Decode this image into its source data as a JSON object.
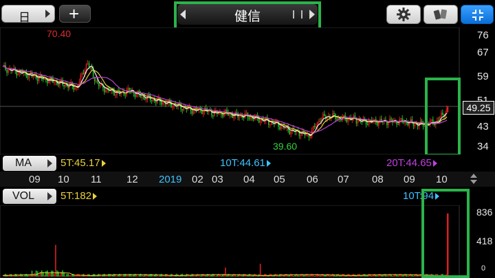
{
  "toolbar": {
    "period_label": "日",
    "add_label": "+",
    "stock_name": "健信",
    "colors": {
      "highlight": "#2bb34a",
      "fullscreen": "#1e90ff"
    }
  },
  "price_panel": {
    "y_ticks": [
      "76",
      "67",
      "59",
      "51",
      "43",
      "34"
    ],
    "current_price": "49.25",
    "high_label": "70.40",
    "low_label": "39.60",
    "colors": {
      "up": "#e01e1e",
      "down": "#1fbf2a",
      "ma5": "#f0f0f0",
      "ma10": "#e6d23a",
      "ma20": "#c040e0"
    }
  },
  "ma_bar": {
    "label": "MA",
    "ma5": "5T:45.17",
    "ma10": "10T:44.61",
    "ma20": "20T:44.65"
  },
  "x_axis": {
    "labels": [
      "09",
      "10",
      "11",
      "12",
      "2019",
      "02",
      "03",
      "04",
      "05",
      "06",
      "07",
      "08",
      "09",
      "10"
    ]
  },
  "vol_bar": {
    "label": "VOL",
    "v5": "5T:182",
    "v10": "10T:94"
  },
  "volume_panel": {
    "y_ticks": [
      "836",
      "418",
      "0"
    ]
  },
  "chart_data": {
    "type": "candlestick",
    "title": "健信",
    "y_range": [
      34,
      76
    ],
    "high": 70.4,
    "low": 39.6,
    "last": 49.25,
    "x_ticks": [
      "09",
      "10",
      "11",
      "12",
      "2019",
      "02",
      "03",
      "04",
      "05",
      "06",
      "07",
      "08",
      "09",
      "10"
    ],
    "close_series": [
      64,
      63,
      62,
      61,
      60,
      59,
      58,
      57,
      66,
      58,
      56,
      55,
      56,
      54,
      53,
      52,
      51,
      50,
      49,
      49,
      48,
      48,
      47,
      47,
      46,
      45,
      44,
      42,
      41,
      40,
      46,
      47,
      46,
      46,
      45,
      45,
      45,
      45,
      45,
      44,
      44,
      45,
      49
    ],
    "volume_ticks": [
      0,
      418,
      836
    ],
    "volume_peak": 836
  }
}
